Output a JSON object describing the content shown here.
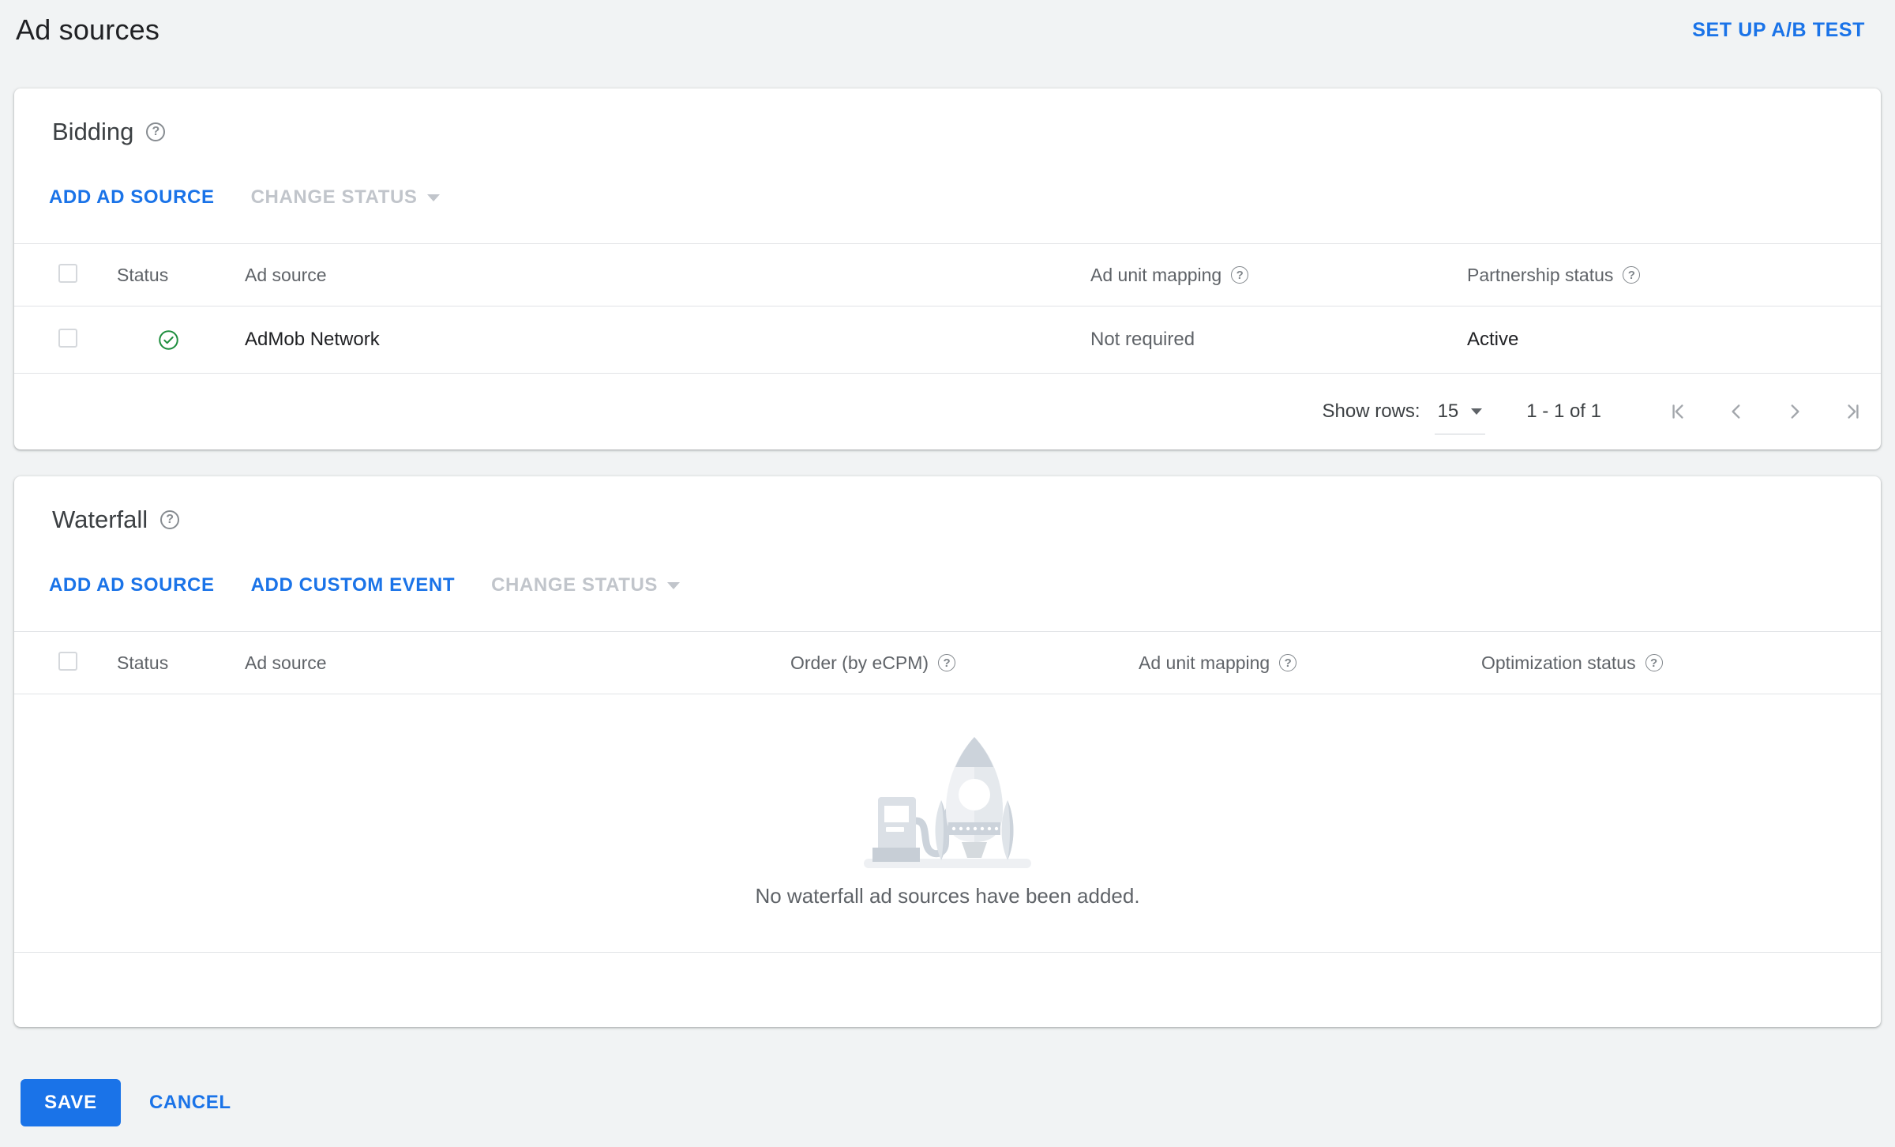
{
  "page": {
    "title": "Ad sources",
    "actions": {
      "setup_ab_test": "SET UP A/B TEST"
    }
  },
  "bidding": {
    "title": "Bidding",
    "toolbar": {
      "add_ad_source": "ADD AD SOURCE",
      "change_status": "CHANGE STATUS"
    },
    "columns": [
      {
        "label": "Status",
        "help": false
      },
      {
        "label": "Ad source",
        "help": false
      },
      {
        "label": "Ad unit mapping",
        "help": true
      },
      {
        "label": "Partnership status",
        "help": true
      }
    ],
    "rows": [
      {
        "status_icon": "check-circle-icon",
        "ad_source": "AdMob Network",
        "ad_unit_mapping": "Not required",
        "partnership_status": "Active"
      }
    ],
    "pagination": {
      "show_rows_label": "Show rows:",
      "page_size": "15",
      "range": "1 - 1 of 1"
    }
  },
  "waterfall": {
    "title": "Waterfall",
    "toolbar": {
      "add_ad_source": "ADD AD SOURCE",
      "add_custom_event": "ADD CUSTOM EVENT",
      "change_status": "CHANGE STATUS"
    },
    "columns": [
      {
        "label": "Status",
        "help": false
      },
      {
        "label": "Ad source",
        "help": false
      },
      {
        "label": "Order (by eCPM)",
        "help": true
      },
      {
        "label": "Ad unit mapping",
        "help": true
      },
      {
        "label": "Optimization status",
        "help": true
      }
    ],
    "empty_message": "No waterfall ad sources have been added."
  },
  "footer": {
    "save": "SAVE",
    "cancel": "CANCEL"
  },
  "icons": {
    "help": "?",
    "dropdown_caret": "caret-down",
    "row_status": "check-circle",
    "pager": [
      "first-page",
      "chevron-left",
      "chevron-right",
      "last-page"
    ],
    "empty_illustration": "rocket-and-fuel-pump"
  },
  "colors": {
    "accent_blue": "#1a73e8",
    "success_green": "#1e8e3e",
    "text_dark": "#202124",
    "text_gray": "#5f6368",
    "disabled_gray": "#c1c5cb",
    "divider": "#e1e3e6",
    "page_bg": "#f1f3f4",
    "card_bg": "#ffffff"
  }
}
